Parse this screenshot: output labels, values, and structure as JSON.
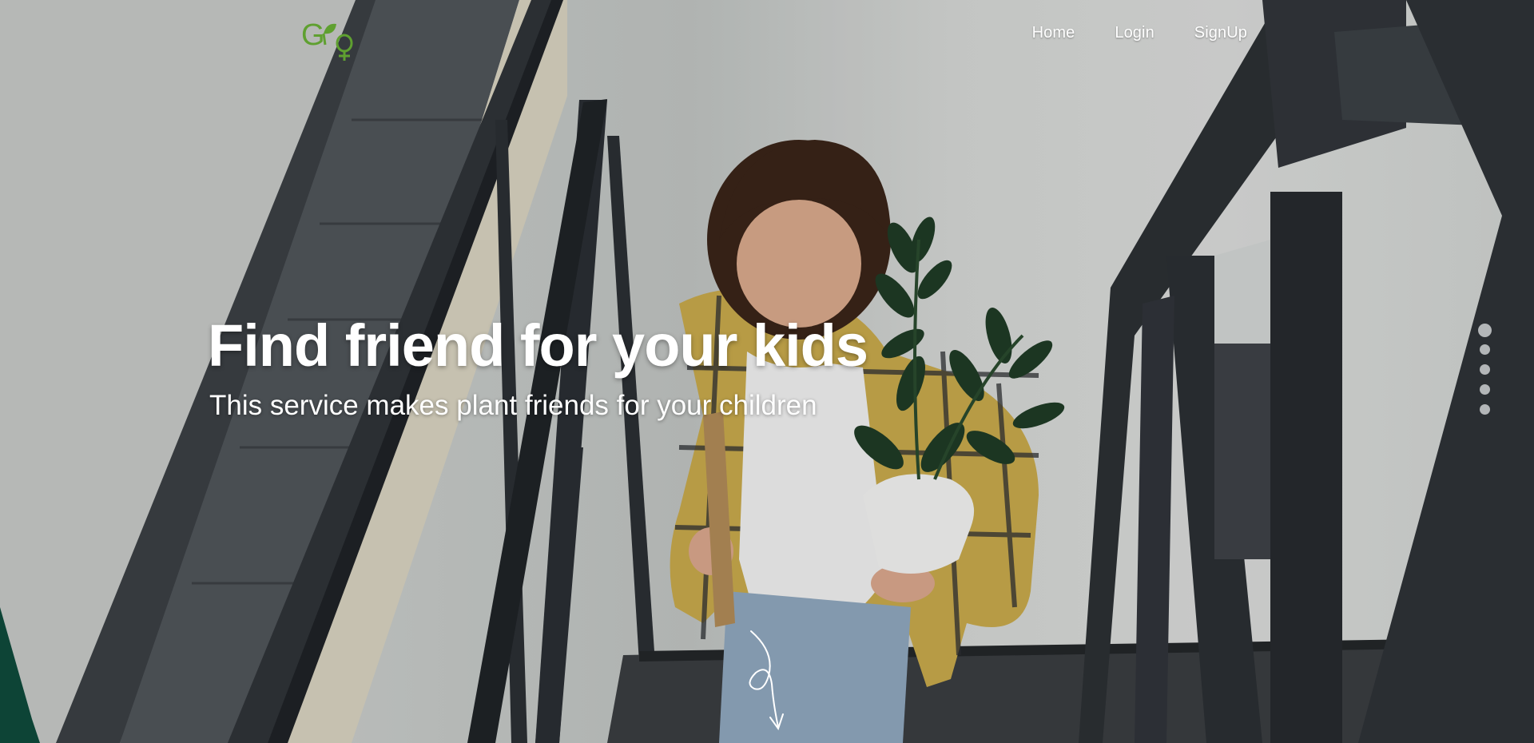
{
  "brand": {
    "logo_text": "GPF",
    "logo_color": "#5fa030"
  },
  "nav": {
    "items": [
      {
        "label": "Home"
      },
      {
        "label": "Login"
      },
      {
        "label": "SignUp"
      }
    ]
  },
  "hero": {
    "headline": "Find friend for your kids",
    "subline": "This service makes plant friends for your children"
  },
  "slider": {
    "dot_count": 5,
    "active_index": 0
  },
  "scroll_indicator": {
    "icon": "scroll-down-arrow-icon"
  },
  "colors": {
    "text": "#ffffff",
    "accent": "#5fa030",
    "rail": "#2a2e33"
  }
}
